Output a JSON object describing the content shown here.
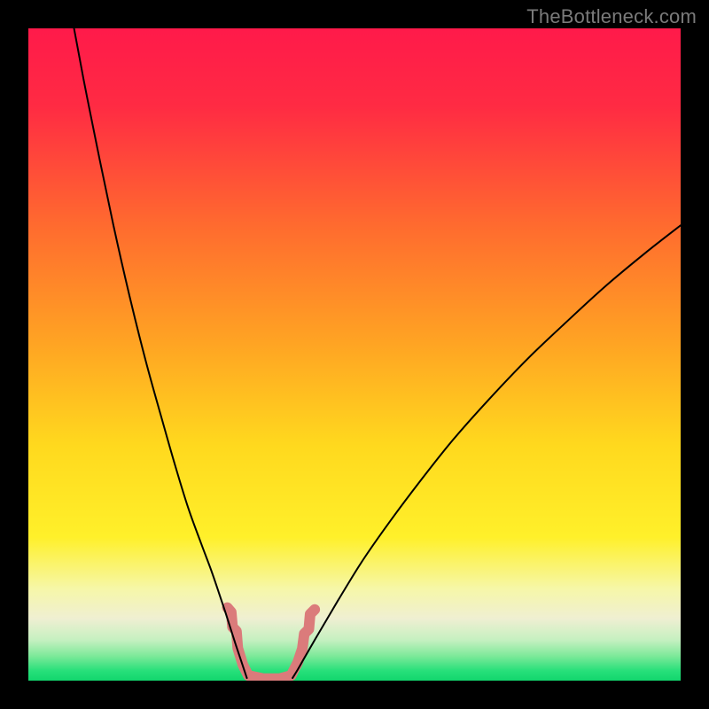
{
  "watermark": "TheBottleneck.com",
  "chart_data": {
    "type": "line",
    "title": "",
    "xlabel": "",
    "ylabel": "",
    "xlim": [
      0,
      100
    ],
    "ylim": [
      0,
      100
    ],
    "gradient_background": {
      "stops": [
        {
          "offset": 0.0,
          "color": "#ff1a4a"
        },
        {
          "offset": 0.12,
          "color": "#ff2b43"
        },
        {
          "offset": 0.3,
          "color": "#ff6a2f"
        },
        {
          "offset": 0.48,
          "color": "#ffa323"
        },
        {
          "offset": 0.64,
          "color": "#ffd91e"
        },
        {
          "offset": 0.78,
          "color": "#fff02a"
        },
        {
          "offset": 0.86,
          "color": "#f6f7a9"
        },
        {
          "offset": 0.905,
          "color": "#efefd2"
        },
        {
          "offset": 0.938,
          "color": "#c5f0c0"
        },
        {
          "offset": 0.962,
          "color": "#7ee99a"
        },
        {
          "offset": 0.985,
          "color": "#27e07a"
        },
        {
          "offset": 1.0,
          "color": "#12d66d"
        }
      ]
    },
    "series": [
      {
        "name": "left-curve",
        "stroke": "#000000",
        "stroke_width_px": 2,
        "points": [
          {
            "x": 7.0,
            "y": 100.0
          },
          {
            "x": 8.5,
            "y": 92.0
          },
          {
            "x": 10.5,
            "y": 82.0
          },
          {
            "x": 13.0,
            "y": 70.0
          },
          {
            "x": 15.5,
            "y": 59.0
          },
          {
            "x": 18.0,
            "y": 49.0
          },
          {
            "x": 20.5,
            "y": 40.0
          },
          {
            "x": 22.5,
            "y": 33.0
          },
          {
            "x": 24.5,
            "y": 26.5
          },
          {
            "x": 26.5,
            "y": 21.0
          },
          {
            "x": 28.0,
            "y": 17.0
          },
          {
            "x": 29.2,
            "y": 13.5
          },
          {
            "x": 30.2,
            "y": 10.5
          },
          {
            "x": 31.0,
            "y": 8.0
          },
          {
            "x": 31.7,
            "y": 5.8
          },
          {
            "x": 32.3,
            "y": 4.0
          },
          {
            "x": 32.8,
            "y": 2.5
          },
          {
            "x": 33.2,
            "y": 1.3
          },
          {
            "x": 33.5,
            "y": 0.4
          }
        ]
      },
      {
        "name": "right-curve",
        "stroke": "#000000",
        "stroke_width_px": 2,
        "points": [
          {
            "x": 40.5,
            "y": 0.4
          },
          {
            "x": 41.3,
            "y": 1.7
          },
          {
            "x": 42.5,
            "y": 3.8
          },
          {
            "x": 44.0,
            "y": 6.4
          },
          {
            "x": 46.0,
            "y": 9.8
          },
          {
            "x": 48.5,
            "y": 14.0
          },
          {
            "x": 51.5,
            "y": 18.8
          },
          {
            "x": 55.5,
            "y": 24.5
          },
          {
            "x": 60.0,
            "y": 30.5
          },
          {
            "x": 65.0,
            "y": 36.8
          },
          {
            "x": 70.5,
            "y": 43.0
          },
          {
            "x": 76.5,
            "y": 49.3
          },
          {
            "x": 82.5,
            "y": 55.0
          },
          {
            "x": 88.5,
            "y": 60.5
          },
          {
            "x": 94.5,
            "y": 65.5
          },
          {
            "x": 100.0,
            "y": 69.8
          }
        ]
      }
    ],
    "trough_band": {
      "name": "trough-band",
      "stroke": "#db7b7b",
      "stroke_width_px": 12,
      "points": [
        {
          "x": 30.5,
          "y": 11.2
        },
        {
          "x": 31.1,
          "y": 10.5
        },
        {
          "x": 31.3,
          "y": 8.2
        },
        {
          "x": 31.9,
          "y": 7.6
        },
        {
          "x": 32.1,
          "y": 5.0
        },
        {
          "x": 32.9,
          "y": 2.4
        },
        {
          "x": 33.7,
          "y": 0.8
        },
        {
          "x": 36.0,
          "y": 0.3
        },
        {
          "x": 38.5,
          "y": 0.3
        },
        {
          "x": 40.3,
          "y": 0.8
        },
        {
          "x": 41.3,
          "y": 2.8
        },
        {
          "x": 42.0,
          "y": 4.9
        },
        {
          "x": 42.3,
          "y": 7.2
        },
        {
          "x": 43.0,
          "y": 7.9
        },
        {
          "x": 43.2,
          "y": 10.2
        },
        {
          "x": 43.9,
          "y": 10.9
        }
      ]
    }
  }
}
